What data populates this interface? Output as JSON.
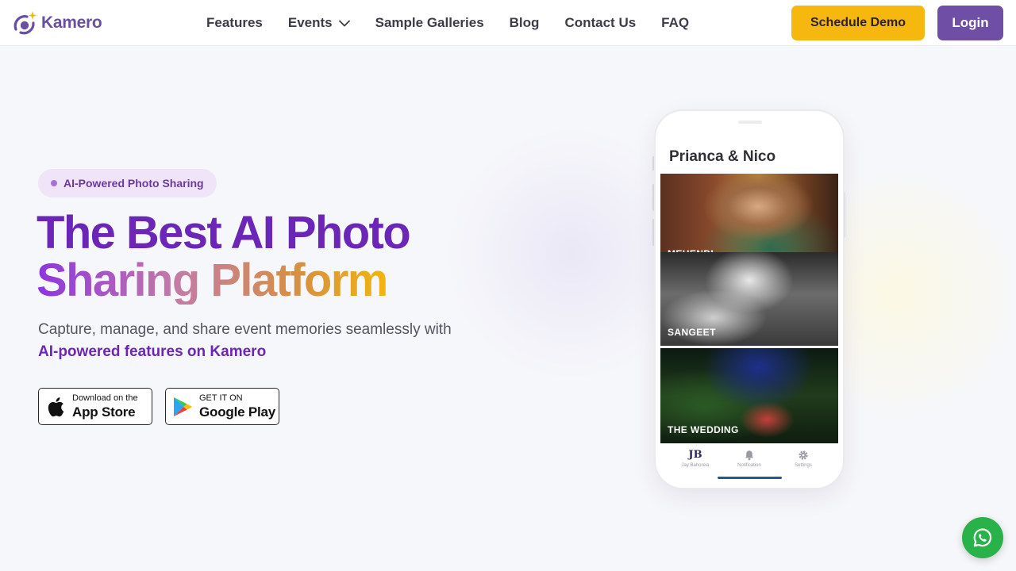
{
  "brand": {
    "name": "Kamero"
  },
  "nav": {
    "items": [
      "Features",
      "Events",
      "Sample Galleries",
      "Blog",
      "Contact Us",
      "FAQ"
    ],
    "schedule_demo": "Schedule Demo",
    "login": "Login"
  },
  "hero": {
    "badge": "AI-Powered Photo Sharing",
    "headline_line1": "The Best AI Photo",
    "headline_line2": "Sharing Platform",
    "subtext": "Capture, manage, and share event memories seamlessly with",
    "subtext_accent": "AI-powered features on Kamero"
  },
  "stores": {
    "apple": {
      "small": "Download on the",
      "big": "App Store"
    },
    "google": {
      "small": "GET IT ON",
      "big": "Google Play"
    }
  },
  "phone": {
    "title": "Prianca & Nico",
    "tiles": [
      "MEHENDI",
      "SANGEET",
      "THE WEDDING"
    ],
    "tabs": {
      "home_mono": "JB",
      "home_label": "Jay Bahoreia",
      "notifications": "Notification",
      "settings": "Settings"
    }
  },
  "colors": {
    "brand_purple": "#6b26b8",
    "demo_yellow": "#f6b70f",
    "login_purple": "#6f4fa6",
    "whatsapp_green": "#2ab24a"
  },
  "icons": [
    "kamero-logo-icon",
    "chevron-down-icon",
    "apple-icon",
    "google-play-icon",
    "bell-icon",
    "gear-icon",
    "whatsapp-icon"
  ]
}
